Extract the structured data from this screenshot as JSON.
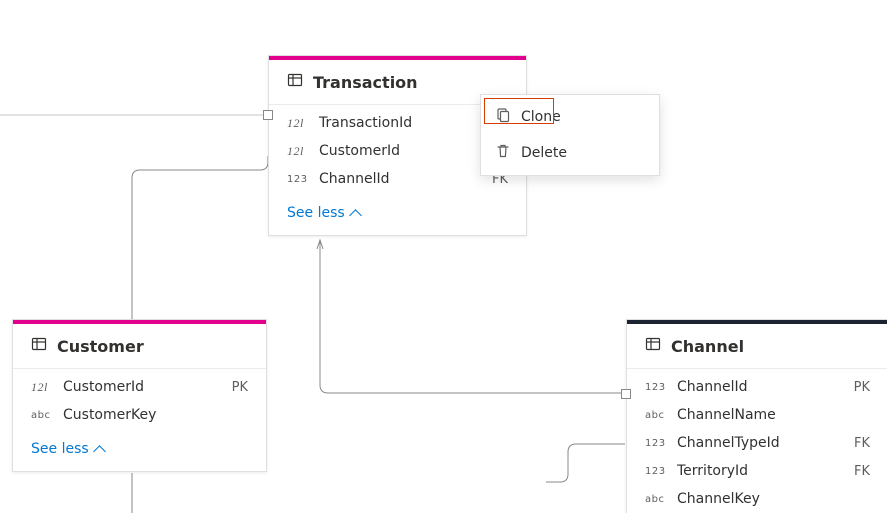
{
  "entities": {
    "transaction": {
      "title": "Transaction",
      "accent": "pink",
      "columns": [
        {
          "type": "12l",
          "name": "TransactionId",
          "key": ""
        },
        {
          "type": "12l",
          "name": "CustomerId",
          "key": ""
        },
        {
          "type": "123",
          "name": "ChannelId",
          "key": "FK"
        }
      ],
      "toggle": "See less"
    },
    "customer": {
      "title": "Customer",
      "accent": "pink",
      "columns": [
        {
          "type": "12l",
          "name": "CustomerId",
          "key": "PK"
        },
        {
          "type": "abc",
          "name": "CustomerKey",
          "key": ""
        }
      ],
      "toggle": "See less"
    },
    "channel": {
      "title": "Channel",
      "accent": "dark",
      "columns": [
        {
          "type": "123",
          "name": "ChannelId",
          "key": "PK"
        },
        {
          "type": "abc",
          "name": "ChannelName",
          "key": ""
        },
        {
          "type": "123",
          "name": "ChannelTypeId",
          "key": "FK"
        },
        {
          "type": "123",
          "name": "TerritoryId",
          "key": "FK"
        },
        {
          "type": "abc",
          "name": "ChannelKey",
          "key": ""
        }
      ]
    }
  },
  "context_menu": {
    "clone": "Clone",
    "delete": "Delete"
  },
  "chart_data": {
    "type": "erd",
    "entities": [
      {
        "name": "Transaction",
        "accentColor": "#e3008c",
        "columns": [
          {
            "name": "TransactionId",
            "dataType": "int64"
          },
          {
            "name": "CustomerId",
            "dataType": "int64"
          },
          {
            "name": "ChannelId",
            "dataType": "int",
            "key": "FK"
          }
        ]
      },
      {
        "name": "Customer",
        "accentColor": "#e3008c",
        "columns": [
          {
            "name": "CustomerId",
            "dataType": "int64",
            "key": "PK"
          },
          {
            "name": "CustomerKey",
            "dataType": "string"
          }
        ]
      },
      {
        "name": "Channel",
        "accentColor": "#1b2430",
        "columns": [
          {
            "name": "ChannelId",
            "dataType": "int",
            "key": "PK"
          },
          {
            "name": "ChannelName",
            "dataType": "string"
          },
          {
            "name": "ChannelTypeId",
            "dataType": "int",
            "key": "FK"
          },
          {
            "name": "TerritoryId",
            "dataType": "int",
            "key": "FK"
          },
          {
            "name": "ChannelKey",
            "dataType": "string"
          }
        ]
      }
    ],
    "relationships": [
      {
        "from": "Transaction.CustomerId",
        "to": "Customer.CustomerId"
      },
      {
        "from": "Transaction.ChannelId",
        "to": "Channel.ChannelId"
      }
    ],
    "context_target": "Transaction",
    "context_highlighted": "Clone"
  }
}
